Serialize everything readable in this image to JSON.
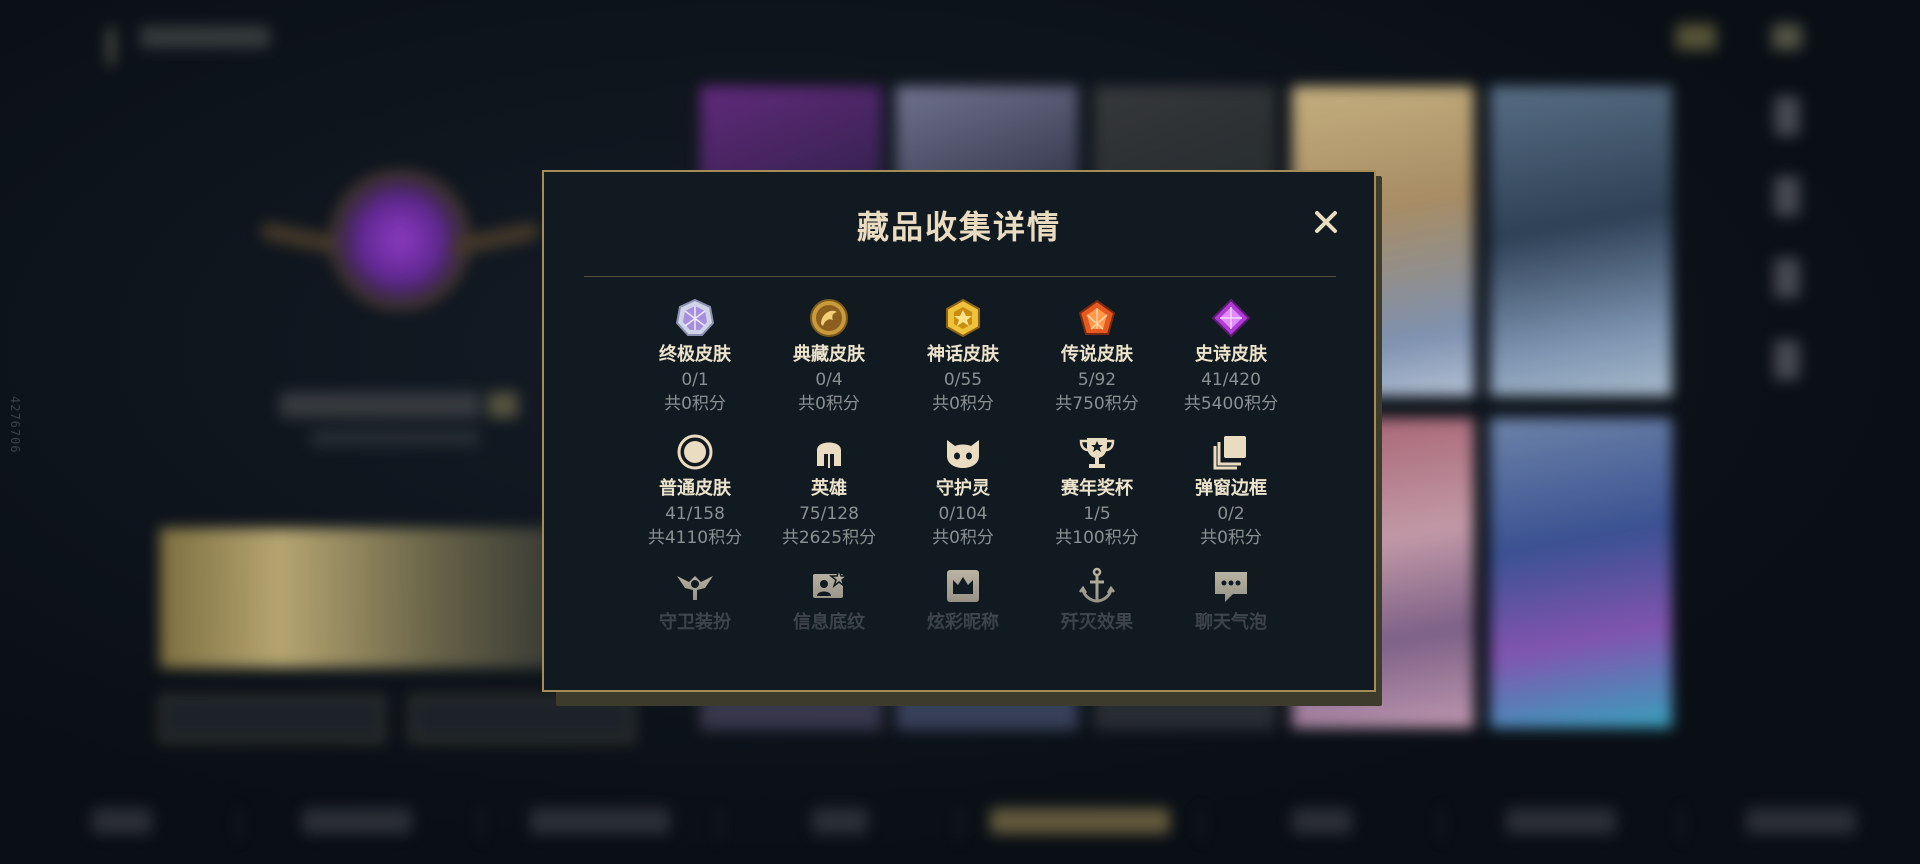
{
  "watermark": "4276706",
  "modal": {
    "title": "藏品收集详情",
    "close_symbol": "✕",
    "items": [
      {
        "label": "终极皮肤",
        "count": "0/1",
        "points": "共0积分",
        "icon": "ultimate-skin-icon"
      },
      {
        "label": "典藏皮肤",
        "count": "0/4",
        "points": "共0积分",
        "icon": "collector-skin-icon"
      },
      {
        "label": "神话皮肤",
        "count": "0/55",
        "points": "共0积分",
        "icon": "mythic-skin-icon"
      },
      {
        "label": "传说皮肤",
        "count": "5/92",
        "points": "共750积分",
        "icon": "legendary-skin-icon"
      },
      {
        "label": "史诗皮肤",
        "count": "41/420",
        "points": "共5400积分",
        "icon": "epic-skin-icon"
      },
      {
        "label": "普通皮肤",
        "count": "41/158",
        "points": "共4110积分",
        "icon": "common-skin-icon"
      },
      {
        "label": "英雄",
        "count": "75/128",
        "points": "共2625积分",
        "icon": "champion-helmet-icon"
      },
      {
        "label": "守护灵",
        "count": "0/104",
        "points": "共0积分",
        "icon": "guardian-spirit-icon"
      },
      {
        "label": "赛年奖杯",
        "count": "1/5",
        "points": "共100积分",
        "icon": "trophy-icon"
      },
      {
        "label": "弹窗边框",
        "count": "0/2",
        "points": "共0积分",
        "icon": "frame-icon"
      },
      {
        "label": "守卫装扮",
        "icon": "ward-skin-icon"
      },
      {
        "label": "信息底纹",
        "icon": "profile-banner-icon"
      },
      {
        "label": "炫彩昵称",
        "icon": "crown-nickname-icon"
      },
      {
        "label": "歼灭效果",
        "icon": "anchor-effect-icon"
      },
      {
        "label": "聊天气泡",
        "icon": "chat-bubble-icon"
      }
    ]
  },
  "colors": {
    "modal_bg": "#111a21",
    "modal_border": "#a18d55",
    "title": "#e9dcc0",
    "label": "#ece3cc",
    "muted": "#8b9091",
    "gold": "#d4b15a"
  }
}
